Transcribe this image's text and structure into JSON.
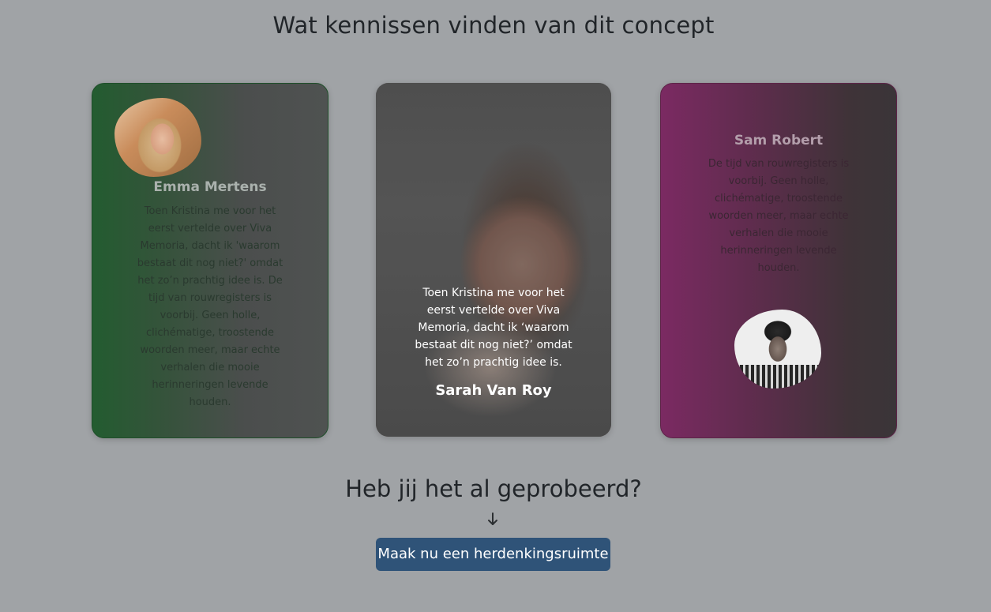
{
  "testimonials_section": {
    "title": "Wat kennissen vinden van dit concept"
  },
  "testimonials": [
    {
      "name": "Emma Mertens",
      "text": "Toen Kristina me voor het eerst vertelde over Viva Memoria, dacht ik 'waarom bestaat dit nog niet?' omdat het zo’n prachtig idee is. De tijd van rouwregisters is voorbij. Geen holle, clichématige, troostende woorden meer, maar echte verhalen die mooie herinneringen levende houden.",
      "accent_color": "#235c30"
    },
    {
      "name": "Sarah Van Roy",
      "text": "Toen Kristina me voor het eerst vertelde over Viva Memoria, dacht ik ‘waarom bestaat dit nog niet?’ omdat het zo’n prachtig idee is."
    },
    {
      "name": "Sam Robert",
      "text": "De tijd van rouwregisters is voorbij. Geen holle, clichématige, troostende woorden meer, maar echte verhalen die mooie herinneringen levende houden.",
      "accent_color": "#7b2a62"
    }
  ],
  "cta": {
    "title": "Heb jij het al geprobeerd?",
    "arrow_icon": "arrow-down-icon",
    "button_label": "Maak nu een herdenkingsruimte",
    "button_color": "#2f5378"
  }
}
